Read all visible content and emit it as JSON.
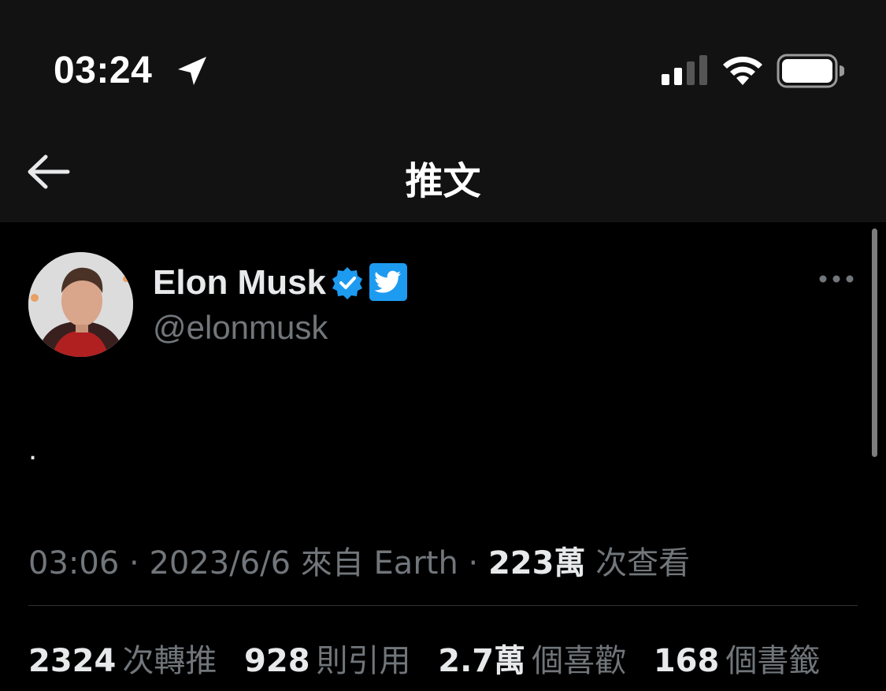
{
  "status_bar": {
    "time": "03:24",
    "signal_bars": 2,
    "battery_level": 1.0
  },
  "nav": {
    "title": "推文"
  },
  "tweet": {
    "author_name": "Elon Musk",
    "author_handle": "@elonmusk",
    "text": ".",
    "time": "03:06",
    "date": "2023/6/6",
    "source_prefix": "來自",
    "source": "Earth",
    "views_count": "223萬",
    "views_label": "次查看",
    "separator": "·"
  },
  "stats": {
    "retweets_value": "2324",
    "retweets_label": "次轉推",
    "quotes_value": "928",
    "quotes_label": "則引用",
    "likes_value": "2.7萬",
    "likes_label": "個喜歡",
    "bookmarks_value": "168",
    "bookmarks_label": "個書籤"
  },
  "colors": {
    "verified_blue": "#1d9bf0",
    "secondary_text": "#71767b",
    "bar_background": "#121212"
  },
  "icons": [
    "location-arrow-icon",
    "cellular-signal-icon",
    "wifi-icon",
    "battery-icon",
    "back-arrow-icon",
    "verified-badge-icon",
    "twitter-bird-icon",
    "more-options-icon"
  ]
}
